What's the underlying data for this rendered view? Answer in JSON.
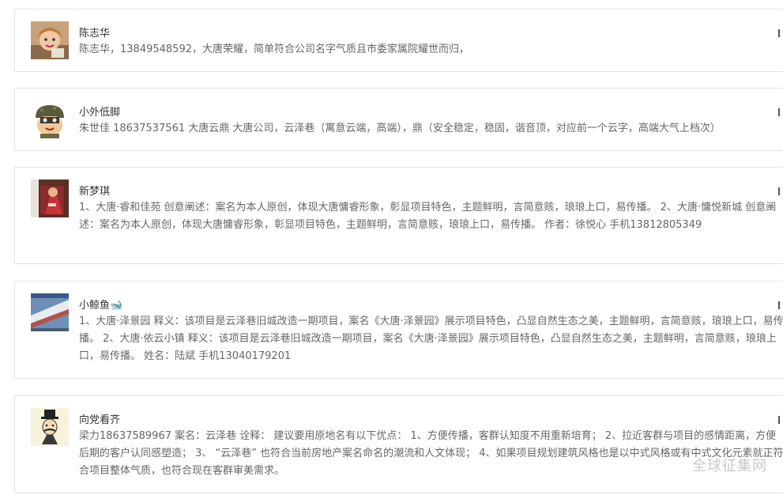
{
  "comments": [
    {
      "name": "陈志华",
      "content": "陈志华，13849548592，大唐荣耀，简单符合公司名字气质且市委家属院耀世而归，",
      "avatar_icon": "baby-photo-avatar"
    },
    {
      "name": "小外低脚",
      "content": "朱世佳 18637537561 大唐云鼎 大唐公司，云泽巷（寓意云端，高端），鼎（安全稳定，稳固，谐音顶，对应前一个云字，高端大气上档次）",
      "avatar_icon": "soldier-cartoon-avatar"
    },
    {
      "name": "新梦琪",
      "content": "1、大唐·睿和佳苑 创意阐述：案名为本人原创，体现大唐慵睿形象，彰显项目特色，主题鲜明，言简意赅，琅琅上口，易传播。 2、大唐·慵悦新城 创意阐述：案名为本人原创，体现大唐慵睿形象，彰显项目特色，主题鲜明，言简意赅，琅琅上口，易传播。 作者：徐悦心 手机13812805349",
      "avatar_icon": "doll-photo-avatar"
    },
    {
      "name": "小鲸鱼🐋",
      "content": "1、大唐·泽景园 释义：该项目是云泽巷旧城改造一期项目，案名《大唐·泽景园》展示项目特色，凸显自然生态之美，主题鲜明，言简意赅，琅琅上口，易传播。 2、大唐·依云小镇 释义：该项目是云泽巷旧城改造一期项目，案名《大唐·泽景园》展示项目特色，凸显自然生态之美，主题鲜明，言简意赅，琅琅上口，易传播。 姓名：陆斌 手机13040179201",
      "avatar_icon": "building-photo-avatar"
    },
    {
      "name": "向党看齐",
      "content": "梁力18637589967 案名：云泽巷 诠释： 建议要用原地名有以下优点： 1、方便传播，客群认知度不用重新培育； 2、拉近客群与项目的感情距离，方便后期的客户认同感塑造； 3、 “云泽巷” 也符合当前房地产案名命名的潮流和人文体现； 4、如果项目规划建筑风格也是以中式风格或有中式文化元素就正符合项目整体气质，也符合现在客群审美需求。",
      "avatar_icon": "gentleman-cartoon-avatar"
    }
  ],
  "watermark": "全球征集网"
}
